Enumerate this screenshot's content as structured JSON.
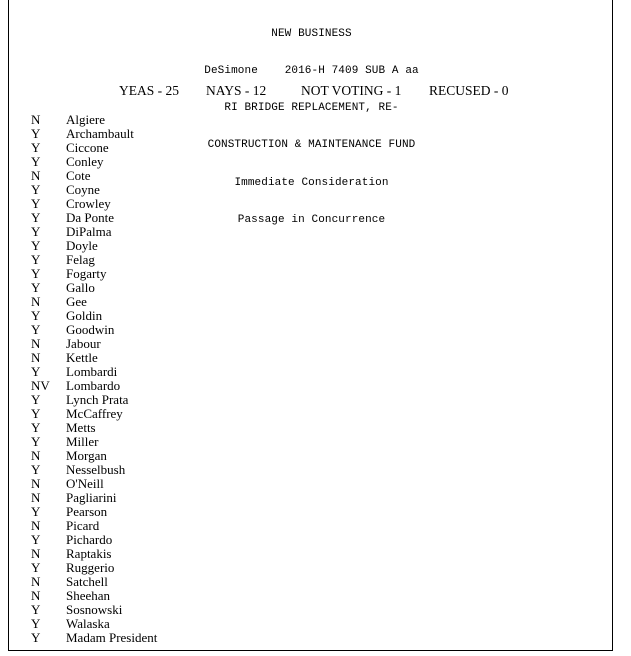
{
  "document": {
    "caption_lines": [
      "NEW BUSINESS",
      "DeSimone    2016-H 7409 SUB A aa",
      "RI BRIDGE REPLACEMENT, RE-",
      "CONSTRUCTION & MAINTENANCE FUND",
      "Immediate Consideration",
      "Passage in Concurrence"
    ]
  },
  "tally": {
    "yeas": "YEAS - 25",
    "nays": "NAYS - 12",
    "not_voting": "NOT VOTING - 1",
    "recused": "RECUSED - 0"
  },
  "rollcall": [
    {
      "vote": "N",
      "name": "Algiere"
    },
    {
      "vote": "Y",
      "name": "Archambault"
    },
    {
      "vote": "Y",
      "name": "Ciccone"
    },
    {
      "vote": "Y",
      "name": "Conley"
    },
    {
      "vote": "N",
      "name": "Cote"
    },
    {
      "vote": "Y",
      "name": "Coyne"
    },
    {
      "vote": "Y",
      "name": "Crowley"
    },
    {
      "vote": "Y",
      "name": "Da Ponte"
    },
    {
      "vote": "Y",
      "name": "DiPalma"
    },
    {
      "vote": "Y",
      "name": "Doyle"
    },
    {
      "vote": "Y",
      "name": "Felag"
    },
    {
      "vote": "Y",
      "name": "Fogarty"
    },
    {
      "vote": "Y",
      "name": "Gallo"
    },
    {
      "vote": "N",
      "name": "Gee"
    },
    {
      "vote": "Y",
      "name": "Goldin"
    },
    {
      "vote": "Y",
      "name": "Goodwin"
    },
    {
      "vote": "N",
      "name": "Jabour"
    },
    {
      "vote": "N",
      "name": "Kettle"
    },
    {
      "vote": "Y",
      "name": "Lombardi"
    },
    {
      "vote": "NV",
      "name": "Lombardo"
    },
    {
      "vote": "Y",
      "name": "Lynch Prata"
    },
    {
      "vote": "Y",
      "name": "McCaffrey"
    },
    {
      "vote": "Y",
      "name": "Metts"
    },
    {
      "vote": "Y",
      "name": "Miller"
    },
    {
      "vote": "N",
      "name": "Morgan"
    },
    {
      "vote": "Y",
      "name": "Nesselbush"
    },
    {
      "vote": "N",
      "name": "O'Neill"
    },
    {
      "vote": "N",
      "name": "Pagliarini"
    },
    {
      "vote": "Y",
      "name": "Pearson"
    },
    {
      "vote": "N",
      "name": "Picard"
    },
    {
      "vote": "Y",
      "name": "Pichardo"
    },
    {
      "vote": "N",
      "name": "Raptakis"
    },
    {
      "vote": "Y",
      "name": "Ruggerio"
    },
    {
      "vote": "N",
      "name": "Satchell"
    },
    {
      "vote": "N",
      "name": "Sheehan"
    },
    {
      "vote": "Y",
      "name": "Sosnowski"
    },
    {
      "vote": "Y",
      "name": "Walaska"
    },
    {
      "vote": "Y",
      "name": "Madam President"
    }
  ]
}
